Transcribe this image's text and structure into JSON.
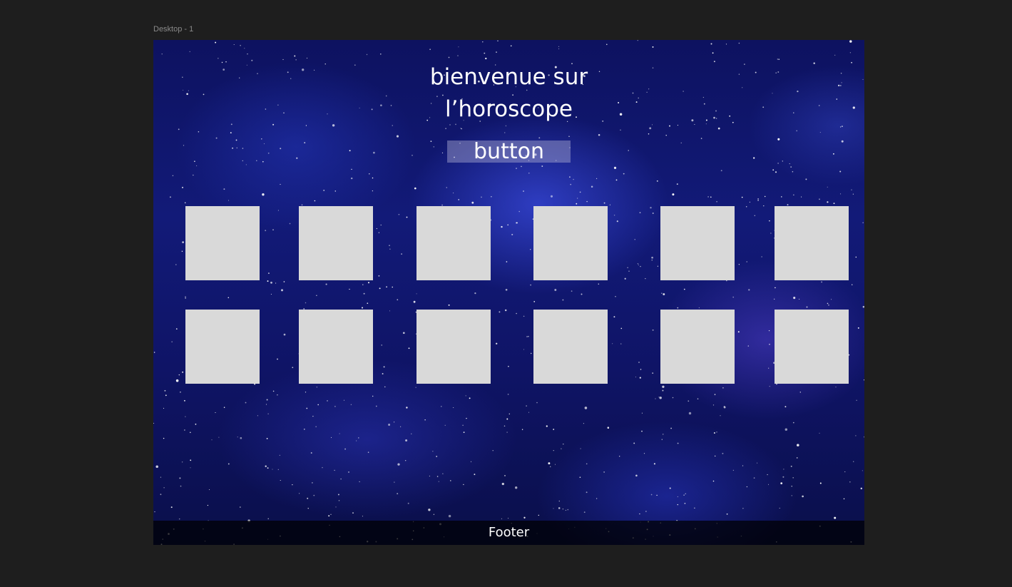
{
  "canvas": {
    "frame_label": "Desktop - 1"
  },
  "header": {
    "title_line1": "bienvenue sur",
    "title_line2": "l’horoscope",
    "button_label": "button"
  },
  "grid": {
    "rows": 2,
    "columns": 6,
    "tile_color": "#d9d9d9"
  },
  "footer": {
    "label": "Footer"
  },
  "colors": {
    "canvas_background": "#1e1e1e",
    "space_background": "#121a78",
    "text": "#ffffff"
  }
}
